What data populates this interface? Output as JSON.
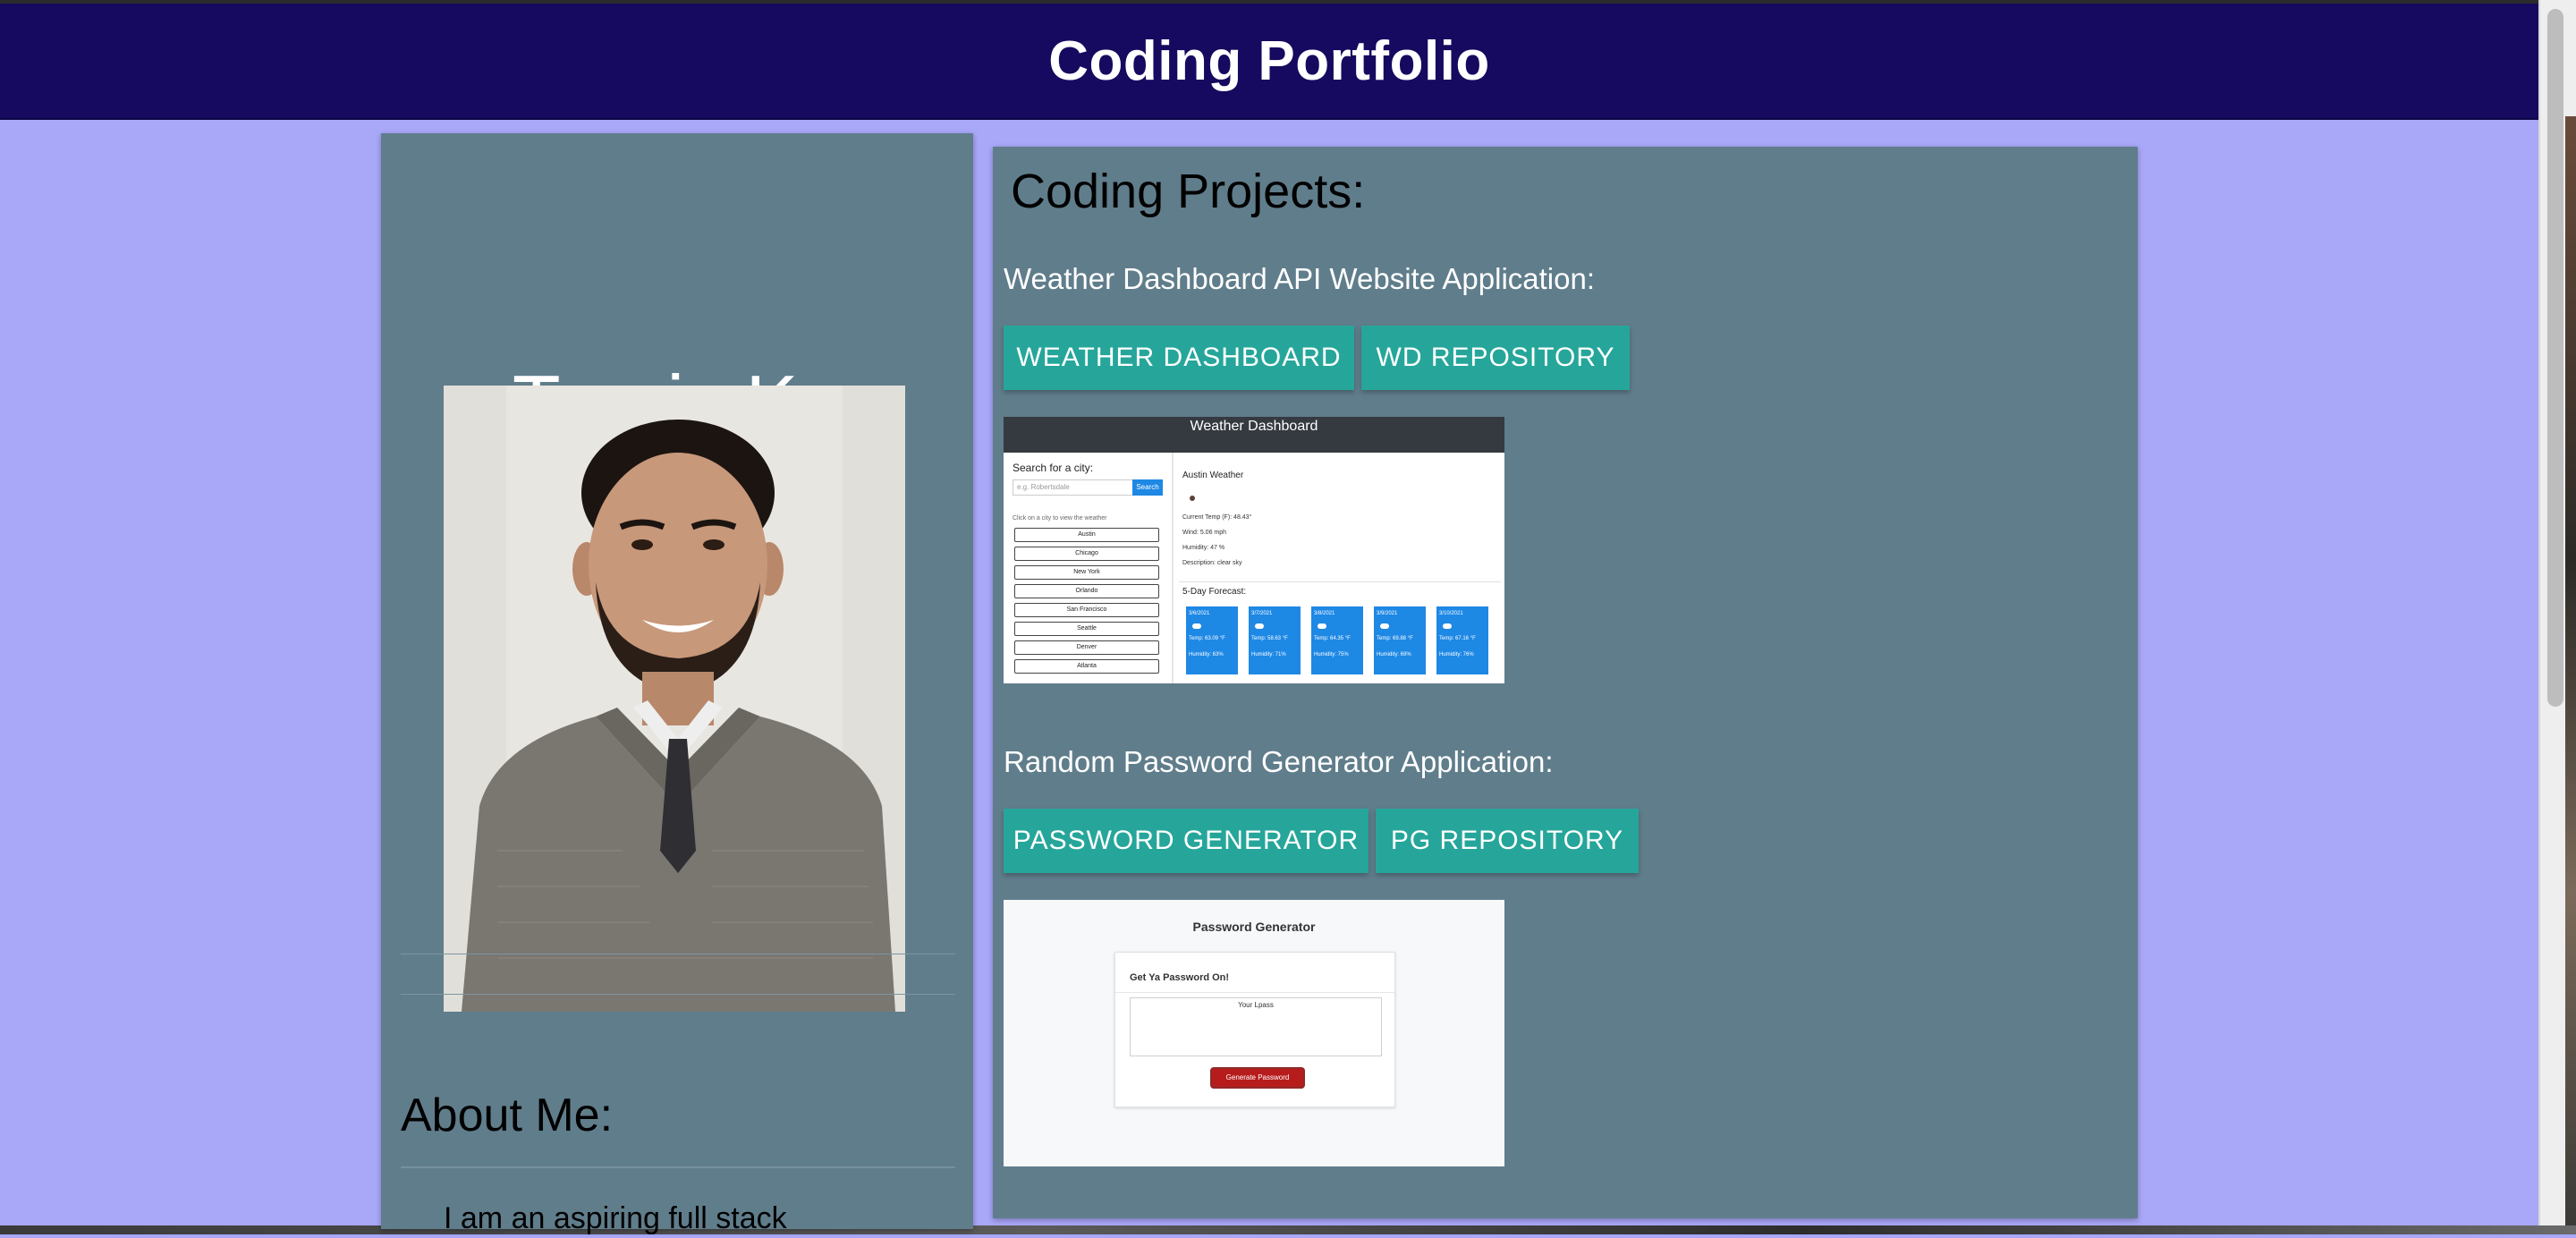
{
  "header": {
    "title": "Coding Portfolio"
  },
  "profile": {
    "name": "Travis Ko",
    "about_heading": "About Me:",
    "about_text": "I am an aspiring full stack"
  },
  "projects": {
    "heading": "Coding Projects:",
    "items": [
      {
        "title": "Weather Dashboard API Website Application:",
        "buttons": [
          "WEATHER DASHBOARD",
          "WD REPOSITORY"
        ]
      },
      {
        "title": "Random Password Generator Application:",
        "buttons": [
          "PASSWORD GENERATOR",
          "PG REPOSITORY"
        ]
      }
    ]
  },
  "weather_shot": {
    "app_title": "Weather Dashboard",
    "search_label": "Search for a city:",
    "search_placeholder": "e.g. Robertsdale",
    "search_button": "Search",
    "hint": "Click on a city to view the weather",
    "cities": [
      "Austin",
      "Chicago",
      "New York",
      "Orlando",
      "San Francisco",
      "Seattle",
      "Denver",
      "Atlanta"
    ],
    "current_title": "Austin Weather",
    "current_lines": [
      "Current Temp (F): 48.43°",
      "Wind: 5.06 mph",
      "Humidity: 47 %",
      "Description: clear sky"
    ],
    "forecast_title": "5-Day Forecast:",
    "forecast": [
      {
        "date": "3/6/2021",
        "temp": "Temp: 63.09 °F",
        "humidity": "Humidity: 63%"
      },
      {
        "date": "3/7/2021",
        "temp": "Temp: 58.63 °F",
        "humidity": "Humidity: 71%"
      },
      {
        "date": "3/8/2021",
        "temp": "Temp: 64.35 °F",
        "humidity": "Humidity: 75%"
      },
      {
        "date": "3/9/2021",
        "temp": "Temp: 69.88 °F",
        "humidity": "Humidity: 69%"
      },
      {
        "date": "3/10/2021",
        "temp": "Temp: 67.16 °F",
        "humidity": "Humidity: 76%"
      }
    ]
  },
  "password_shot": {
    "title": "Password Generator",
    "subtitle": "Get Ya Password On!",
    "placeholder": "Your Lpass",
    "button": "Generate Password"
  },
  "colors": {
    "header_bg": "#150a5f",
    "page_bg": "#a9a7f8",
    "card_bg": "#607d8b",
    "button_bg": "#26a69a",
    "weather_accent": "#1e88e5",
    "password_button": "#b71c1c"
  }
}
